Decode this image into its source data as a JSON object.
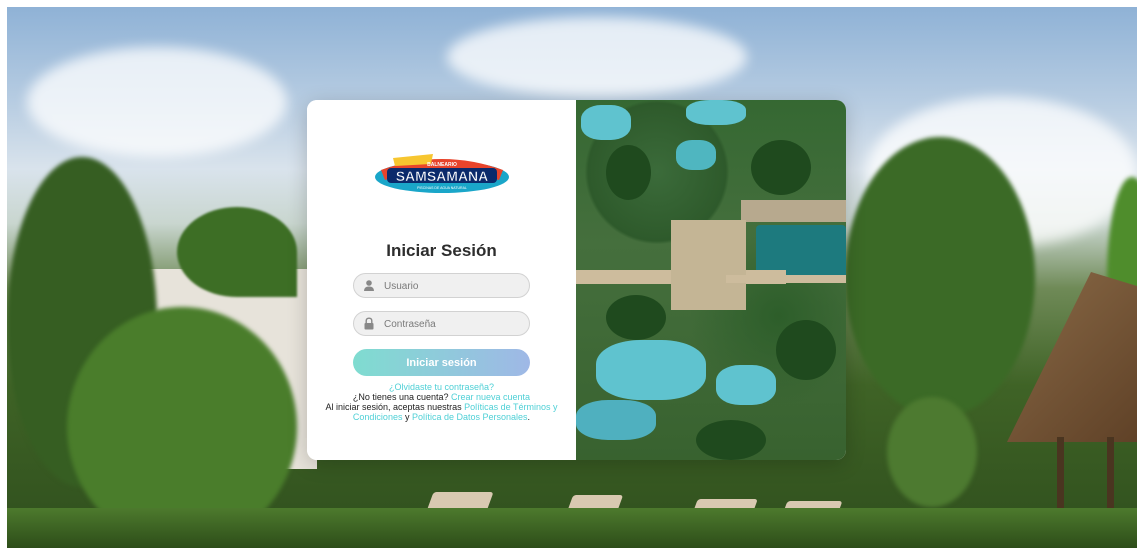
{
  "brand": {
    "logo_name": "samsamana-logo",
    "logo_line1": "BALNEARIO",
    "logo_line2": "SAMSAMANA",
    "logo_line3": "PISCINAS DE AGUA NATURAL"
  },
  "login": {
    "title": "Iniciar Sesión",
    "username_placeholder": "Usuario",
    "password_placeholder": "Contraseña",
    "submit_label": "Iniciar sesión",
    "forgot_link": "¿Olvidaste tu contraseña?",
    "no_account_text": "¿No tienes una cuenta? ",
    "create_account_link": "Crear nueva cuenta",
    "terms_prefix": "Al iniciar sesión, aceptas nuestras ",
    "terms_link": "Políticas de Términos y Condiciones",
    "terms_and": " y ",
    "privacy_link": "Política de Datos Personales",
    "terms_suffix": "."
  },
  "colors": {
    "accent": "#4fd0d6",
    "button_start": "#7fdcd0",
    "button_end": "#9fb8e6"
  },
  "icons": {
    "username": "user-icon",
    "password": "lock-icon"
  }
}
